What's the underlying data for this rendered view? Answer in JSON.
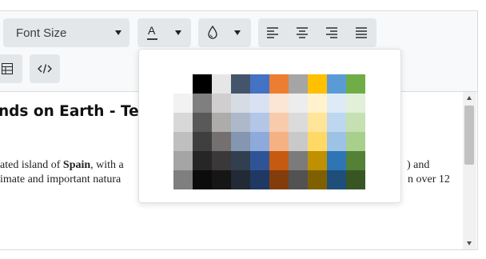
{
  "toolbar": {
    "font_size_label": "Font Size",
    "font_color_label": "A",
    "accent_underline": "#3d3d3d"
  },
  "content": {
    "heading": "nds on Earth - Ter",
    "line1_pre": "ated island of ",
    "line1_bold": "Spain",
    "line1_mid": ", with a",
    "line1_right": ") and",
    "line2_left": "imate and important natura",
    "line2_right": "n over 12"
  },
  "palette": {
    "top_row": [
      null,
      "#000000",
      "#e7e6e6",
      "#44546a",
      "#4472c4",
      "#ed7d31",
      "#a5a5a5",
      "#ffc000",
      "#5b9bd5",
      "#70ad47"
    ],
    "shades": [
      [
        "#f2f2f2",
        "#7f7f7f",
        "#d0cece",
        "#d6dce4",
        "#d9e2f3",
        "#fbe5d5",
        "#ededed",
        "#fff2cc",
        "#deebf6",
        "#e2efd9"
      ],
      [
        "#d8d8d8",
        "#595959",
        "#aeabab",
        "#adb9ca",
        "#b4c6e7",
        "#f7cbac",
        "#dbdbdb",
        "#fee599",
        "#bdd7ee",
        "#c5e0b3"
      ],
      [
        "#bfbfbf",
        "#3f3f3f",
        "#757070",
        "#8496b0",
        "#8eaadb",
        "#f4b183",
        "#c9c9c9",
        "#ffd965",
        "#9cc3e5",
        "#a8d08d"
      ],
      [
        "#a5a5a5",
        "#262626",
        "#3a3838",
        "#323f4f",
        "#2f5496",
        "#c55a11",
        "#7b7b7b",
        "#bf9000",
        "#2e75b5",
        "#538135"
      ],
      [
        "#7f7f7f",
        "#0c0c0c",
        "#171616",
        "#222a35",
        "#1f3864",
        "#833c0b",
        "#525252",
        "#7f6000",
        "#1e4e79",
        "#375623"
      ]
    ]
  }
}
